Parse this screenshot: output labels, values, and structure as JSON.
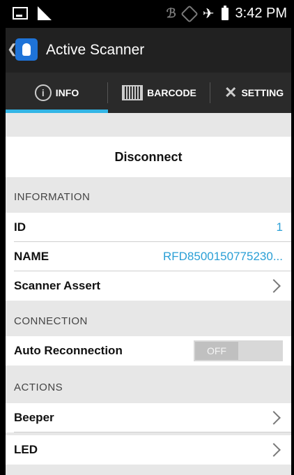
{
  "statusbar": {
    "time": "3:42 PM"
  },
  "app": {
    "title": "Active Scanner"
  },
  "tabs": [
    {
      "label": "INFO",
      "icon": "info-icon",
      "selected": true
    },
    {
      "label": "BARCODE",
      "icon": "barcode-icon",
      "selected": false
    },
    {
      "label": "SETTING",
      "icon": "wrench-icon",
      "selected": false
    }
  ],
  "colors": {
    "accent": "#33b5e5",
    "value_text": "#2a9fd6",
    "actionbar": "#212121"
  },
  "disconnect_label": "Disconnect",
  "sections": {
    "information": {
      "header": "INFORMATION",
      "id_label": "ID",
      "id_value": "1",
      "name_label": "NAME",
      "name_value": "RFD8500150775230...",
      "scanner_assert_label": "Scanner Assert"
    },
    "connection": {
      "header": "CONNECTION",
      "auto_reconnect_label": "Auto Reconnection",
      "auto_reconnect_state": "OFF"
    },
    "actions": {
      "header": "ACTIONS",
      "beeper_label": "Beeper",
      "led_label": "LED"
    }
  }
}
